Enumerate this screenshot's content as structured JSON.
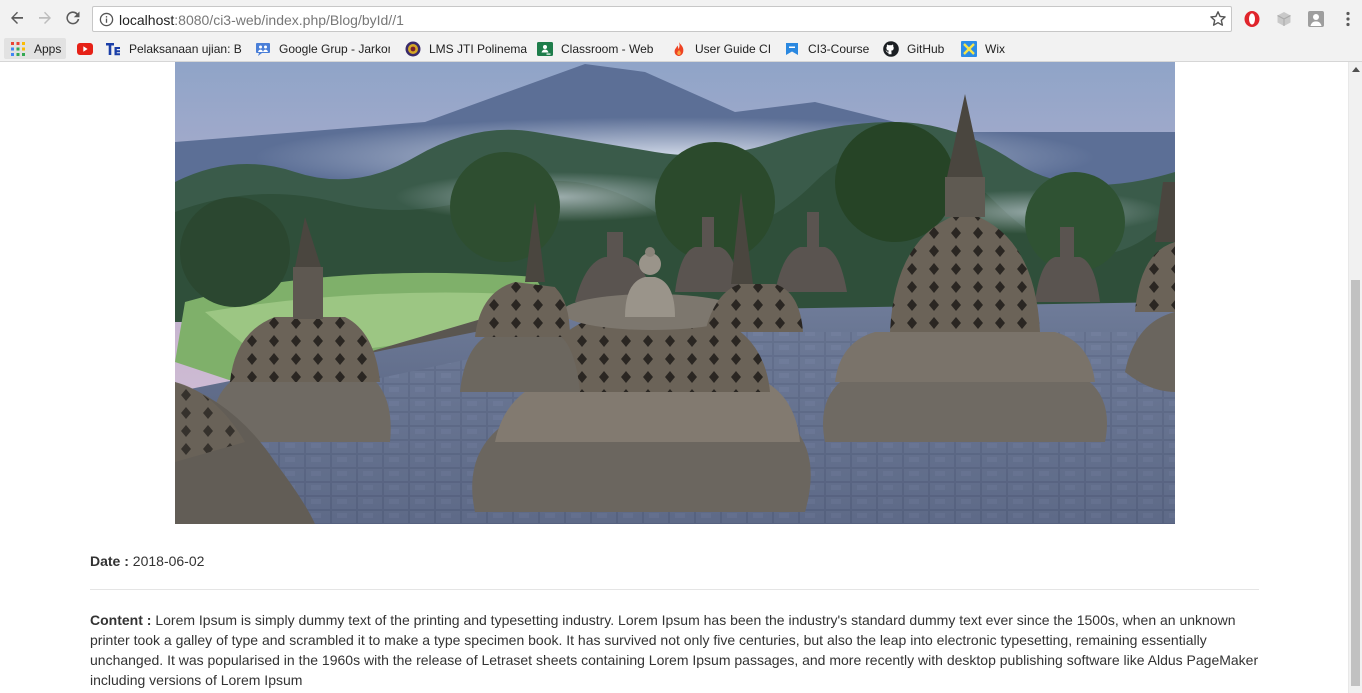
{
  "browser": {
    "url_host": "localhost",
    "url_path": ":8080/ci3-web/index.php/Blog/byId//1",
    "bookmarks": [
      {
        "label": "Apps",
        "icon": "apps-grid-icon"
      },
      {
        "label": "",
        "icon": "youtube-icon"
      },
      {
        "label": "Pelaksanaan ujian: Ba",
        "icon": "te-icon"
      },
      {
        "label": "Google Grup - Jarkom",
        "icon": "google-groups-icon"
      },
      {
        "label": "LMS JTI Polinema",
        "icon": "polinema-icon"
      },
      {
        "label": "Classroom - Web",
        "icon": "classroom-icon"
      },
      {
        "label": "User Guide CI",
        "icon": "codeigniter-icon"
      },
      {
        "label": "CI3-Course",
        "icon": "bookmark-icon"
      },
      {
        "label": "GitHub",
        "icon": "github-icon"
      },
      {
        "label": "Wix",
        "icon": "wix-icon"
      }
    ]
  },
  "post": {
    "date_label": "Date :",
    "date_value": "2018-06-02",
    "content_label": "Content :",
    "content_text": "Lorem Ipsum is simply dummy text of the printing and typesetting industry. Lorem Ipsum has been the industry's standard dummy text ever since the 1500s, when an unknown printer took a galley of type and scrambled it to make a type specimen book. It has survived not only five centuries, but also the leap into electronic typesetting, remaining essentially unchanged. It was popularised in the 1960s with the release of Letraset sheets containing Lorem Ipsum passages, and more recently with desktop publishing software like Aldus PageMaker including versions of Lorem Ipsum"
  },
  "colors": {
    "chrome_bg": "#f2f2f2",
    "text": "#333333",
    "youtube_red": "#e62117",
    "opera_red": "#e0252c"
  }
}
